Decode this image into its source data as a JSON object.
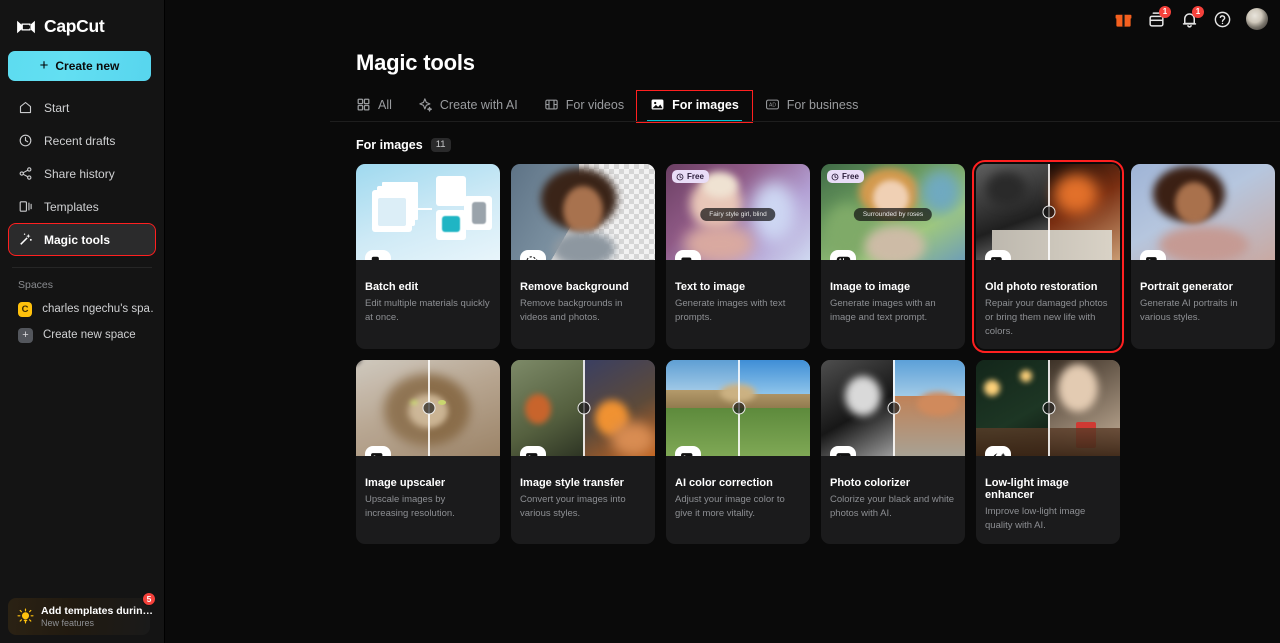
{
  "brand": {
    "name": "CapCut",
    "logo_icon": "capcut-logo-icon"
  },
  "sidebar": {
    "create_new_label": "Create new",
    "items": [
      {
        "label": "Start",
        "icon": "home-icon"
      },
      {
        "label": "Recent drafts",
        "icon": "clock-icon"
      },
      {
        "label": "Share history",
        "icon": "share-icon"
      },
      {
        "label": "Templates",
        "icon": "templates-icon"
      },
      {
        "label": "Magic tools",
        "icon": "magic-wand-icon"
      }
    ],
    "spaces_label": "Spaces",
    "spaces": [
      {
        "label": "charles ngechu's spa…",
        "initial": "C"
      },
      {
        "label": "Create new space",
        "initial": "+"
      }
    ],
    "promo": {
      "title": "Add templates durin…",
      "subtitle": "New features",
      "badge": "5",
      "icon": "lightbulb-icon"
    }
  },
  "topbar": {
    "icons": [
      {
        "name": "gift-icon",
        "badge": ""
      },
      {
        "name": "inbox-icon",
        "badge": "1"
      },
      {
        "name": "bell-icon",
        "badge": "1"
      },
      {
        "name": "help-icon",
        "badge": ""
      }
    ],
    "avatar_name": "user-avatar"
  },
  "header": {
    "title": "Magic tools"
  },
  "tabs": [
    {
      "label": "All",
      "icon": "grid-icon",
      "active": false
    },
    {
      "label": "Create with AI",
      "icon": "sparkle-icon",
      "active": false
    },
    {
      "label": "For videos",
      "icon": "film-icon",
      "active": false
    },
    {
      "label": "For images",
      "icon": "image-icon",
      "active": true
    },
    {
      "label": "For business",
      "icon": "business-icon",
      "active": false
    }
  ],
  "section": {
    "label": "For images",
    "count": "11"
  },
  "cards": [
    {
      "title": "Batch edit",
      "desc": "Edit multiple materials quickly at once.",
      "icon": "batch-edit-icon",
      "thumb": "t-batch",
      "free": false,
      "prompt": "",
      "slider": false,
      "selected": false
    },
    {
      "title": "Remove background",
      "desc": "Remove backgrounds in videos and photos.",
      "icon": "remove-bg-icon",
      "thumb": "t-remove",
      "free": false,
      "prompt": "",
      "slider": false,
      "selected": false
    },
    {
      "title": "Text to image",
      "desc": "Generate images with text prompts.",
      "icon": "text-to-image-icon",
      "thumb": "t-text2img",
      "free": true,
      "free_label": "Free",
      "prompt": "Fairy style girl, blind",
      "slider": false,
      "selected": false
    },
    {
      "title": "Image to image",
      "desc": "Generate images with an image and text prompt.",
      "icon": "image-to-image-icon",
      "thumb": "t-img2img",
      "free": true,
      "free_label": "Free",
      "prompt": "Surrounded by roses",
      "slider": false,
      "selected": false
    },
    {
      "title": "Old photo restoration",
      "desc": "Repair your damaged photos or bring them new life with colors.",
      "icon": "old-photo-icon",
      "thumb": "t-oldphoto",
      "free": false,
      "prompt": "",
      "slider": true,
      "selected": true
    },
    {
      "title": "Portrait generator",
      "desc": "Generate AI portraits in various styles.",
      "icon": "portrait-icon",
      "thumb": "t-portrait",
      "free": false,
      "prompt": "",
      "slider": false,
      "selected": false
    },
    {
      "title": "Image upscaler",
      "desc": "Upscale images by increasing resolution.",
      "icon": "upscale-4k-icon",
      "thumb": "t-upscale",
      "free": false,
      "prompt": "",
      "slider": true,
      "selected": false
    },
    {
      "title": "Image style transfer",
      "desc": "Convert your images into various styles.",
      "icon": "style-transfer-icon",
      "thumb": "t-style",
      "free": false,
      "prompt": "",
      "slider": true,
      "selected": false
    },
    {
      "title": "AI color correction",
      "desc": "Adjust your image color to give it more vitality.",
      "icon": "color-correction-icon",
      "thumb": "t-color",
      "free": false,
      "prompt": "",
      "slider": true,
      "selected": false
    },
    {
      "title": "Photo colorizer",
      "desc": "Colorize your black and white photos with AI.",
      "icon": "colorizer-icon",
      "thumb": "t-colorizer",
      "free": false,
      "prompt": "",
      "slider": true,
      "selected": false
    },
    {
      "title": "Low-light image enhancer",
      "desc": "Improve low-light image quality with AI.",
      "icon": "moon-star-icon",
      "thumb": "t-lowlight",
      "free": false,
      "prompt": "",
      "slider": true,
      "selected": false
    }
  ],
  "colors": {
    "accent": "#00c4d4",
    "create_new": "#5ddcf0",
    "badge_red": "#f5413b",
    "highlight_red": "#ff2020"
  }
}
